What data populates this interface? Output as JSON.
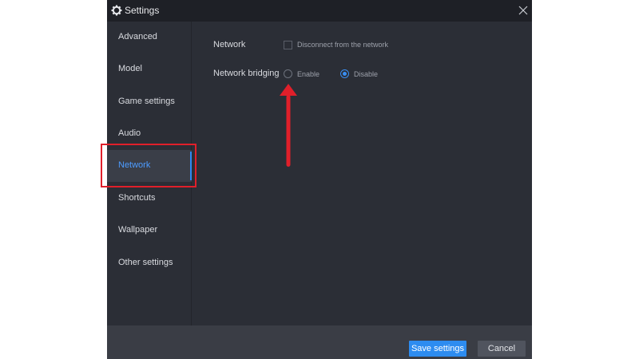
{
  "window": {
    "title": "Settings"
  },
  "sidebar": {
    "items": [
      {
        "label": "Advanced"
      },
      {
        "label": "Model"
      },
      {
        "label": "Game settings"
      },
      {
        "label": "Audio"
      },
      {
        "label": "Network",
        "active": true
      },
      {
        "label": "Shortcuts"
      },
      {
        "label": "Wallpaper"
      },
      {
        "label": "Other settings"
      }
    ]
  },
  "main": {
    "network": {
      "label": "Network",
      "checkbox_label": "Disconnect from the network",
      "checked": false
    },
    "bridging": {
      "label": "Network bridging",
      "options": [
        {
          "label": "Enable",
          "selected": false
        },
        {
          "label": "Disable",
          "selected": true
        }
      ]
    }
  },
  "footer": {
    "save_label": "Save settings",
    "cancel_label": "Cancel"
  },
  "colors": {
    "accent": "#2d8cf0",
    "annotation": "#e01f2a",
    "background": "#2b2e36",
    "titlebar": "#1e2026"
  },
  "icons": {
    "title": "gear-icon",
    "close": "close-icon"
  }
}
